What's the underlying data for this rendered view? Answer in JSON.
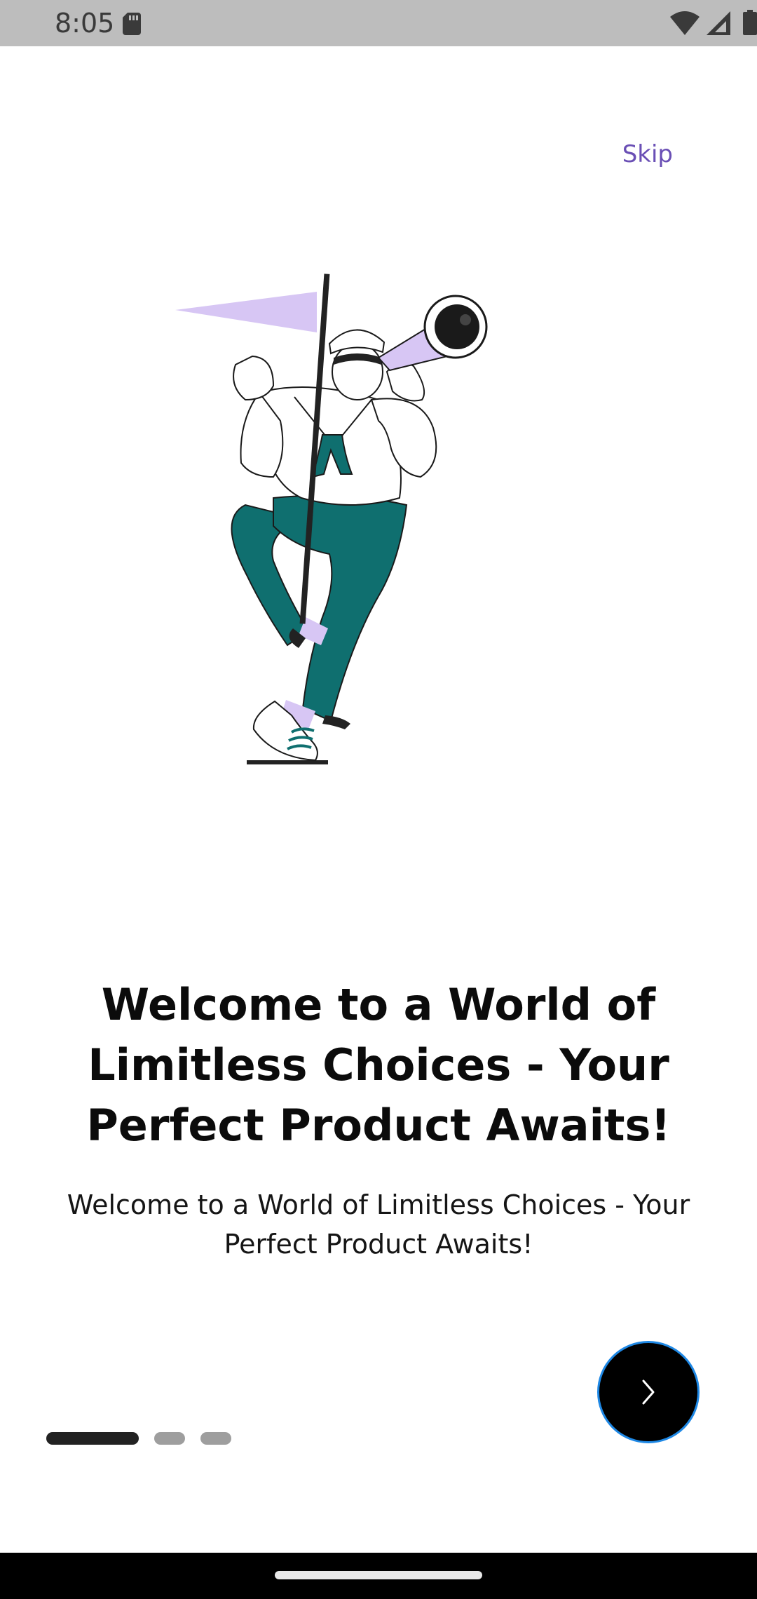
{
  "status_bar": {
    "time": "8:05",
    "icons": [
      "sd-card-icon",
      "wifi-icon",
      "cellular-signal-icon",
      "battery-icon"
    ]
  },
  "onboarding": {
    "skip_label": "Skip",
    "title": "Welcome to a World of Limitless Choices - Your Perfect Product Awaits!",
    "subtitle": "Welcome to a World of Limitless Choices - Your Perfect Product Awaits!",
    "illustration": "sailor-with-telescope-illustration",
    "page_indicator": {
      "total": 3,
      "active_index": 0
    },
    "next_button_icon": "chevron-right-icon"
  },
  "colors": {
    "accent": "#6a4fb5",
    "teal": "#0f6f6f",
    "lavender": "#d7c6f4",
    "button": "#000000",
    "button_border": "#1e88e5",
    "indicator_active": "#222222",
    "indicator_inactive": "#9e9e9e"
  }
}
